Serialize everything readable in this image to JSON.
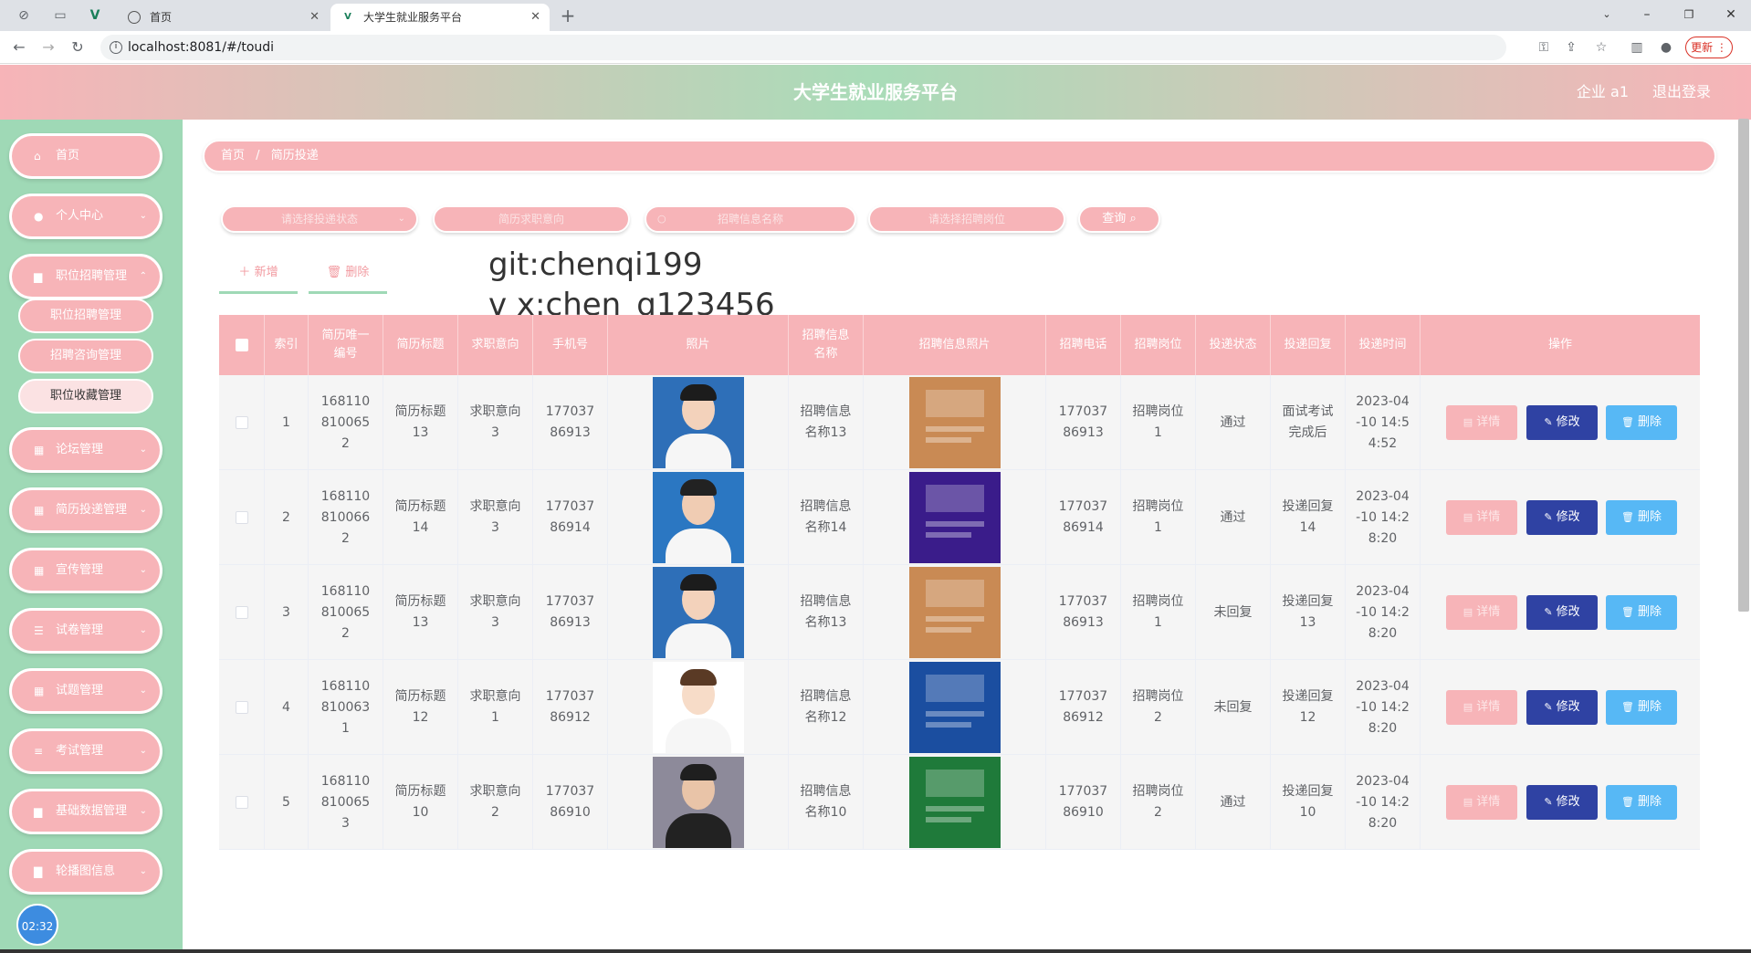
{
  "browser": {
    "tabs": [
      {
        "title": "首页"
      },
      {
        "title": "大学生就业服务平台"
      }
    ],
    "url": "localhost:8081/#/toudi",
    "update_label": "更新"
  },
  "header": {
    "title": "大学生就业服务平台",
    "user": "企业 a1",
    "logout": "退出登录"
  },
  "sidebar": {
    "items": [
      {
        "label": "首页",
        "icon": "home-icon"
      },
      {
        "label": "个人中心",
        "icon": "user-icon"
      },
      {
        "label": "职位招聘管理",
        "icon": "briefcase-icon"
      },
      {
        "label": "论坛管理",
        "icon": "grid-icon"
      },
      {
        "label": "简历投递管理",
        "icon": "table-icon"
      },
      {
        "label": "宣传管理",
        "icon": "grid-icon"
      },
      {
        "label": "试卷管理",
        "icon": "sliders-icon"
      },
      {
        "label": "试题管理",
        "icon": "grid-icon"
      },
      {
        "label": "考试管理",
        "icon": "list-icon"
      },
      {
        "label": "基础数据管理",
        "icon": "briefcase-icon"
      },
      {
        "label": "轮播图信息",
        "icon": "chart-icon"
      }
    ],
    "submenu": [
      "职位招聘管理",
      "招聘咨询管理",
      "职位收藏管理"
    ],
    "clock": "02:32"
  },
  "breadcrumb": {
    "home": "首页",
    "sep": "/",
    "current": "简历投递"
  },
  "filters": {
    "status": "请选择投递状态",
    "intent": "简历求职意向",
    "recruit_name": "招聘信息名称",
    "position": "请选择招聘岗位",
    "query": "查询"
  },
  "actions": {
    "add": "新增",
    "delete": "删除"
  },
  "watermark": [
    "git:chenqi199",
    "v x:chen_q123456"
  ],
  "table": {
    "headers": [
      "索引",
      "简历唯一编号",
      "简历标题",
      "求职意向",
      "手机号",
      "照片",
      "招聘信息名称",
      "招聘信息照片",
      "招聘电话",
      "招聘岗位",
      "投递状态",
      "投递回复",
      "投递时间",
      "操作"
    ],
    "buttons": {
      "detail": "详情",
      "edit": "修改",
      "delete": "删除"
    },
    "rows": [
      {
        "idx": "1",
        "code": "1681108100652",
        "title": "简历标题13",
        "intent": "求职意向3",
        "phone": "17703786913",
        "recruit": "招聘信息名称13",
        "tel": "17703786913",
        "post": "招聘岗位1",
        "status": "通过",
        "reply": "面试考试完成后",
        "time": "2023-04-10 14:54:52"
      },
      {
        "idx": "2",
        "code": "1681108100662",
        "title": "简历标题14",
        "intent": "求职意向3",
        "phone": "17703786914",
        "recruit": "招聘信息名称14",
        "tel": "17703786914",
        "post": "招聘岗位1",
        "status": "通过",
        "reply": "投递回复14",
        "time": "2023-04-10 14:28:20"
      },
      {
        "idx": "3",
        "code": "1681108100652",
        "title": "简历标题13",
        "intent": "求职意向3",
        "phone": "17703786913",
        "recruit": "招聘信息名称13",
        "tel": "17703786913",
        "post": "招聘岗位1",
        "status": "未回复",
        "reply": "投递回复13",
        "time": "2023-04-10 14:28:20"
      },
      {
        "idx": "4",
        "code": "1681108100631",
        "title": "简历标题12",
        "intent": "求职意向1",
        "phone": "17703786912",
        "recruit": "招聘信息名称12",
        "tel": "17703786912",
        "post": "招聘岗位2",
        "status": "未回复",
        "reply": "投递回复12",
        "time": "2023-04-10 14:28:20"
      },
      {
        "idx": "5",
        "code": "1681108100653",
        "title": "简历标题10",
        "intent": "求职意向2",
        "phone": "17703786910",
        "recruit": "招聘信息名称10",
        "tel": "17703786910",
        "post": "招聘岗位2",
        "status": "通过",
        "reply": "投递回复10",
        "time": "2023-04-10 14:28:20"
      }
    ]
  },
  "colors": {
    "pink": "#f7b4b8",
    "green": "#9fd9b6",
    "edit": "#2f42a3",
    "delete": "#57b8f5"
  }
}
